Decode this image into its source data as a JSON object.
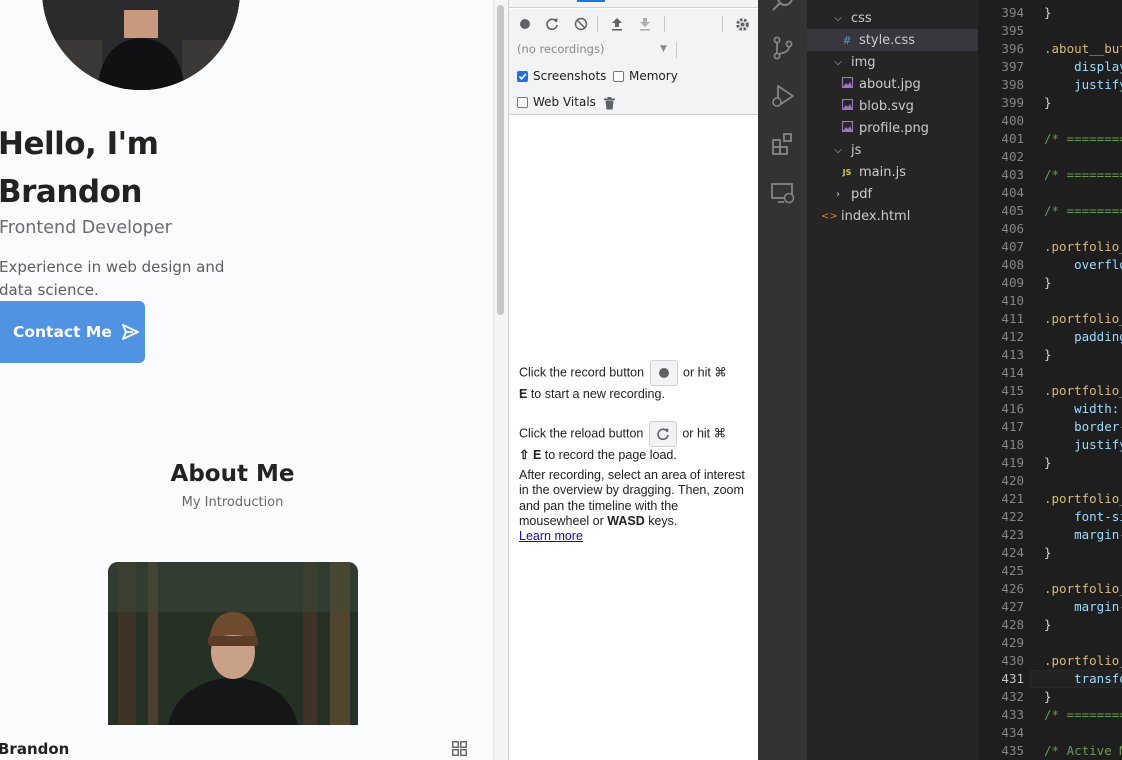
{
  "portfolio": {
    "hero_title": "Hello, I'm Brandon",
    "hero_subtitle": "Frontend Developer",
    "hero_description": "Experience in web design and data science.",
    "contact_button": "Contact Me",
    "about_title": "About Me",
    "about_subtitle": "My Introduction",
    "nav_logo": "Brandon",
    "accent_color": "#5193e3"
  },
  "devtools": {
    "recordings_select": "(no recordings)",
    "checkboxes": [
      {
        "label": "Screenshots",
        "checked": true
      },
      {
        "label": "Memory",
        "checked": false
      },
      {
        "label": "Web Vitals",
        "checked": false
      }
    ],
    "hint_record_pre": "Click the record button",
    "hint_record_post": "or hit ⌘",
    "hint_record_key": "E",
    "hint_record_end": "to start a new recording.",
    "hint_reload_pre": "Click the reload button",
    "hint_reload_post": "or hit ⌘",
    "hint_reload_key": "⇧ E",
    "hint_reload_end": "to record the page load.",
    "hint_after_1": "After recording, select an area of interest in the overview by dragging. Then, zoom and pan the timeline with the mousewheel or",
    "hint_after_key": "WASD",
    "hint_after_2": "keys.",
    "learn_more": "Learn more"
  },
  "explorer": {
    "items": [
      {
        "label": "css",
        "type": "folder",
        "open": true,
        "level": 1
      },
      {
        "label": "style.css",
        "type": "css",
        "level": 2,
        "selected": true
      },
      {
        "label": "img",
        "type": "folder",
        "open": true,
        "level": 1
      },
      {
        "label": "about.jpg",
        "type": "image",
        "level": 2
      },
      {
        "label": "blob.svg",
        "type": "image",
        "level": 2
      },
      {
        "label": "profile.png",
        "type": "image",
        "level": 2
      },
      {
        "label": "js",
        "type": "folder",
        "open": true,
        "level": 1
      },
      {
        "label": "main.js",
        "type": "js",
        "level": 2
      },
      {
        "label": "pdf",
        "type": "folder",
        "open": false,
        "level": 1
      },
      {
        "label": "index.html",
        "type": "html",
        "level": 0
      }
    ]
  },
  "editor": {
    "active_line": "431",
    "lines": [
      {
        "n": "394",
        "code": "}"
      },
      {
        "n": "395",
        "code": ""
      },
      {
        "n": "396",
        "code": ".about__but"
      },
      {
        "n": "397",
        "code": "    display"
      },
      {
        "n": "398",
        "code": "    justify"
      },
      {
        "n": "399",
        "code": "}"
      },
      {
        "n": "400",
        "code": ""
      },
      {
        "n": "401",
        "code": "/* ========"
      },
      {
        "n": "402",
        "code": ""
      },
      {
        "n": "403",
        "code": "/* ========"
      },
      {
        "n": "404",
        "code": ""
      },
      {
        "n": "405",
        "code": "/* ========"
      },
      {
        "n": "406",
        "code": ""
      },
      {
        "n": "407",
        "code": ".portfolio_"
      },
      {
        "n": "408",
        "code": "    overflo"
      },
      {
        "n": "409",
        "code": "}"
      },
      {
        "n": "410",
        "code": ""
      },
      {
        "n": "411",
        "code": ".portfolio_"
      },
      {
        "n": "412",
        "code": "    padding"
      },
      {
        "n": "413",
        "code": "}"
      },
      {
        "n": "414",
        "code": ""
      },
      {
        "n": "415",
        "code": ".portfolio_"
      },
      {
        "n": "416",
        "code": "    width: "
      },
      {
        "n": "417",
        "code": "    border-"
      },
      {
        "n": "418",
        "code": "    justify"
      },
      {
        "n": "419",
        "code": "}"
      },
      {
        "n": "420",
        "code": ""
      },
      {
        "n": "421",
        "code": ".portfolio_"
      },
      {
        "n": "422",
        "code": "    font-si"
      },
      {
        "n": "423",
        "code": "    margin-"
      },
      {
        "n": "424",
        "code": "}"
      },
      {
        "n": "425",
        "code": ""
      },
      {
        "n": "426",
        "code": ".portfolio_"
      },
      {
        "n": "427",
        "code": "    margin-"
      },
      {
        "n": "428",
        "code": "}"
      },
      {
        "n": "429",
        "code": ""
      },
      {
        "n": "430",
        "code": ".portfolio_"
      },
      {
        "n": "431",
        "code": "    transfo"
      },
      {
        "n": "432",
        "code": "}"
      },
      {
        "n": "433",
        "code": "/* ========"
      },
      {
        "n": "434",
        "code": ""
      },
      {
        "n": "435",
        "code": "/* Active M"
      }
    ]
  }
}
